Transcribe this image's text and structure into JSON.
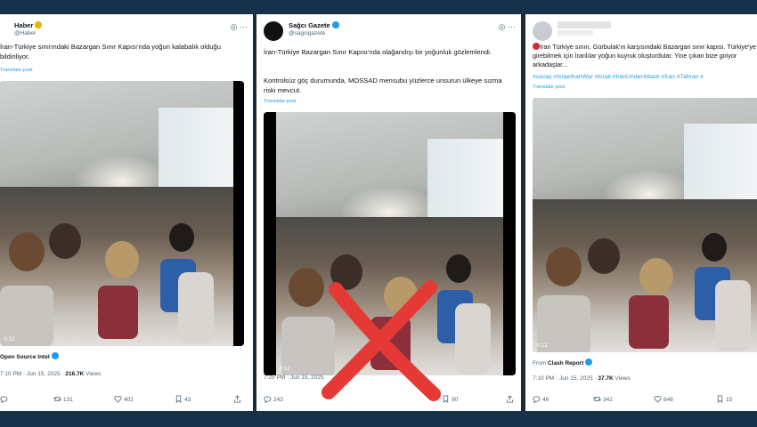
{
  "cards": [
    {
      "name": "Haber",
      "handle": "@Haber",
      "text": "İran-Türkiye sınırındaki Bazargan Sınır Kapısı'nda yoğun kalabalık olduğu bildiriliyor.",
      "translate": "Translate post",
      "timecode": "0:12",
      "source_prefix": "",
      "source": "Open Source Intel",
      "time": "7:10 PM · Jun 15, 2025",
      "views": "216.7K",
      "views_label": "Views",
      "replies": "",
      "reposts": "131",
      "likes": "402",
      "bookmarks": "43"
    },
    {
      "name": "Sağcı Gazete",
      "handle": "@sagcigazete",
      "text": "İran-Türkiye Bazargan Sınır Kapısı'nda olağandışı bir yoğunluk gözlemlendi.",
      "text2": "Kontrolsüz göç durumunda, MOSSAD mensubu yüzlerce unsurun ülkeye sızma riski mevcut.",
      "translate": "Translate post",
      "timecode": "0:12",
      "time": "7:25 PM · Jun 15, 2025",
      "replies": "243",
      "reposts": "",
      "likes": "",
      "bookmarks": "90"
    },
    {
      "name": "",
      "handle": "",
      "text": "İran Türkiye sınırı, Gürbulak'ın karşısındaki Bazargan sınır kapısı. Türkiye'ye girebilmek için İranlılar yoğun kuyruk oluşturdular. Yine çıkan bize giriyor arkadaşlar...",
      "hashtags": "#savaş #IsraelIranWar #Israil #IranUnderAttack #İran #Tahran #",
      "translate": "Translate post",
      "timecode": "0:12",
      "source_prefix": "From",
      "source": "Clash Report",
      "time": "7:10 PM · Jun 15, 2025",
      "views": "37.7K",
      "views_label": "Views",
      "replies": "46",
      "reposts": "342",
      "likes": "848",
      "bookmarks": "15"
    }
  ],
  "colors": {
    "background": "#1b2b3a",
    "link": "#1d9bf0",
    "cross": "#e53935"
  }
}
